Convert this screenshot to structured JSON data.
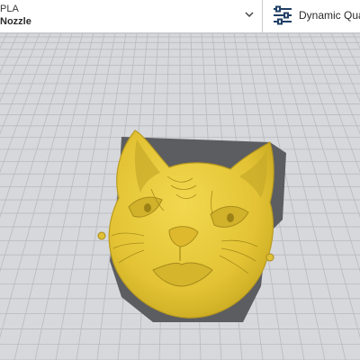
{
  "toolbar": {
    "material": "PLA",
    "nozzle": "Nozzle",
    "profile": "Dynamic Quali"
  },
  "icons": {
    "material_dropdown": "chevron-down-icon",
    "print_settings": "sliders-icon"
  },
  "colors": {
    "model": "#e8c93a",
    "model_shadow": "#b89a1f",
    "build_plate": "#d7d8dc",
    "grid_line": "#b9babe",
    "footprint": "#5c5d61"
  }
}
